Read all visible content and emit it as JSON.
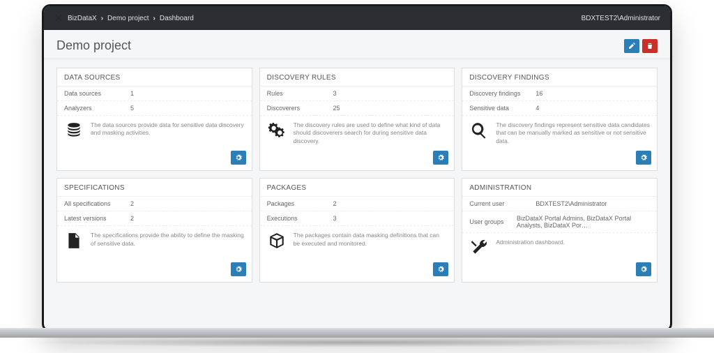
{
  "breadcrumbs": {
    "app": "BizDataX",
    "project": "Demo project",
    "page": "Dashboard"
  },
  "current_user": "BDXTEST2\\Administrator",
  "page_title": "Demo project",
  "cards": {
    "data_sources": {
      "title": "DATA SOURCES",
      "rows": [
        {
          "label": "Data sources",
          "value": "1"
        },
        {
          "label": "Analyzers",
          "value": "5"
        }
      ],
      "desc": "The data sources provide data for sensitive data discovery and masking activities."
    },
    "discovery_rules": {
      "title": "DISCOVERY RULES",
      "rows": [
        {
          "label": "Rules",
          "value": "3"
        },
        {
          "label": "Discoverers",
          "value": "25"
        }
      ],
      "desc": "The discovery rules are used to define what kind of data should discoverers search for during sensitive data discovery."
    },
    "discovery_findings": {
      "title": "DISCOVERY FINDINGS",
      "rows": [
        {
          "label": "Discovery findings",
          "value": "16"
        },
        {
          "label": "Sensitive data",
          "value": "4"
        }
      ],
      "desc": "The discovery findings represent sensitive data candidates that can be manually marked as sensitive or not sensitive data."
    },
    "specifications": {
      "title": "SPECIFICATIONS",
      "rows": [
        {
          "label": "All specifications",
          "value": "2"
        },
        {
          "label": "Latest versions",
          "value": "2"
        }
      ],
      "desc": "The specifications provide the ability to define the masking of sensitive data."
    },
    "packages": {
      "title": "PACKAGES",
      "rows": [
        {
          "label": "Packages",
          "value": "2"
        },
        {
          "label": "Executions",
          "value": "3"
        }
      ],
      "desc": "The packages contain data masking definitions that can be executed and monitored."
    },
    "administration": {
      "title": "ADMINISTRATION",
      "rows": [
        {
          "label": "Current user",
          "value": "BDXTEST2\\Administrator"
        },
        {
          "label": "User groups",
          "value": "BizDataX Portal Admins, BizDataX Portal Analysts, BizDataX Por…"
        }
      ],
      "desc": "Administration dashboard."
    }
  }
}
